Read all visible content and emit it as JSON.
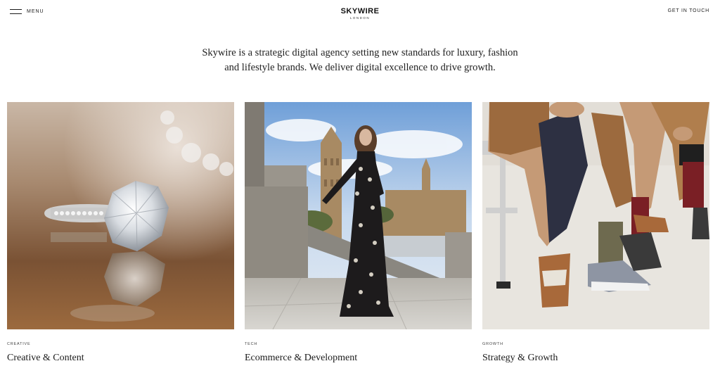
{
  "header": {
    "menu_label": "MENU",
    "brand_title": "SKYWIRE",
    "brand_subtitle": "LONDON",
    "contact_label": "GET IN TOUCH"
  },
  "intro": {
    "line1": "Skywire is a strategic digital agency setting new standards for luxury, fashion",
    "line2": "and lifestyle brands. We deliver digital excellence to drive growth."
  },
  "cards": [
    {
      "tag": "CREATIVE",
      "title": "Creative & Content",
      "image": "diamond-ring-photo"
    },
    {
      "tag": "TECH",
      "title": "Ecommerce & Development",
      "image": "woman-in-london-photo"
    },
    {
      "tag": "GROWTH",
      "title": "Strategy & Growth",
      "image": "sneakers-legs-photo"
    }
  ],
  "colors": {
    "text": "#1a1a1a",
    "background": "#ffffff"
  }
}
